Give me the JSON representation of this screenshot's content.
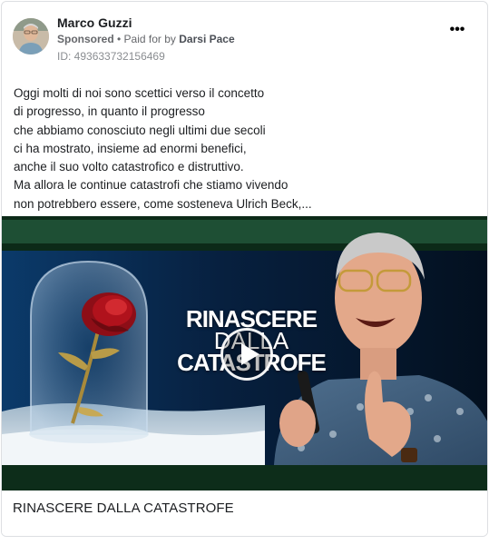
{
  "post": {
    "author": "Marco Guzzi",
    "sponsored_label": "Sponsored",
    "separator": " • ",
    "paid_prefix": "Paid for by",
    "payer": "Darsi Pace",
    "ad_id": "ID: 493633732156469",
    "more_icon": "more-options-icon",
    "text": "Oggi molti di noi sono scettici verso il concetto\ndi progresso, in quanto il progresso\nche abbiamo conosciuto negli ultimi due secoli\nci ha mostrato, insieme ad enormi benefici,\nanche il suo volto catastrofico e distruttivo.\nMa allora le continue catastrofi che stiamo vivendo\nnon potrebbero essere, come sosteneva Ulrich Beck,..."
  },
  "media": {
    "title_line1": "RINASCERE",
    "title_line2": "DALLA",
    "title_line3": "CATASTROFE",
    "play_icon": "play-icon",
    "colors": {
      "frame": "#0c2a18",
      "bg_dark": "#061a3a",
      "rose": "#b0121c"
    }
  },
  "caption": "RINASCERE DALLA CATASTROFE"
}
